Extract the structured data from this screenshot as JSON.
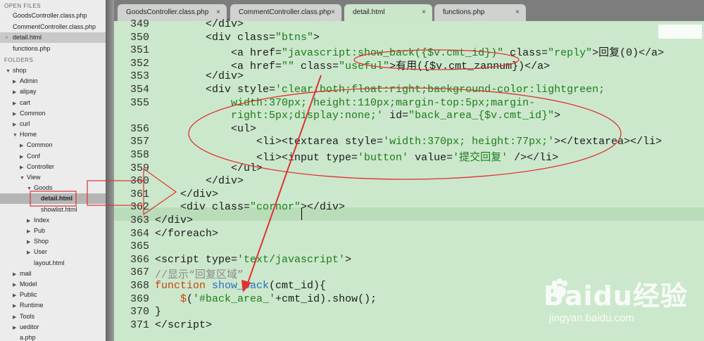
{
  "sidebar": {
    "open_files_header": "OPEN FILES",
    "folders_header": "FOLDERS",
    "open_files": [
      {
        "label": "GoodsController.class.php",
        "active": false
      },
      {
        "label": "CommentController.class.php",
        "active": false
      },
      {
        "label": "detail.html",
        "active": true
      },
      {
        "label": "functions.php",
        "active": false
      }
    ],
    "tree": [
      {
        "label": "shop",
        "depth": 0,
        "expanded": true
      },
      {
        "label": "Admin",
        "depth": 1,
        "expanded": false
      },
      {
        "label": "alipay",
        "depth": 1,
        "expanded": false
      },
      {
        "label": "cart",
        "depth": 1,
        "expanded": false
      },
      {
        "label": "Common",
        "depth": 1,
        "expanded": false
      },
      {
        "label": "curl",
        "depth": 1,
        "expanded": false
      },
      {
        "label": "Home",
        "depth": 1,
        "expanded": true
      },
      {
        "label": "Common",
        "depth": 2,
        "expanded": false
      },
      {
        "label": "Conf",
        "depth": 2,
        "expanded": false
      },
      {
        "label": "Controller",
        "depth": 2,
        "expanded": false
      },
      {
        "label": "View",
        "depth": 2,
        "expanded": true
      },
      {
        "label": "Goods",
        "depth": 3,
        "expanded": true
      },
      {
        "label": "detail.html",
        "depth": 4,
        "file": true,
        "selected": true
      },
      {
        "label": "showlist.html",
        "depth": 4,
        "file": true
      },
      {
        "label": "Index",
        "depth": 3,
        "expanded": false
      },
      {
        "label": "Pub",
        "depth": 3,
        "expanded": false
      },
      {
        "label": "Shop",
        "depth": 3,
        "expanded": false
      },
      {
        "label": "User",
        "depth": 3,
        "expanded": false
      },
      {
        "label": "layout.html",
        "depth": 3,
        "file": true
      },
      {
        "label": "mail",
        "depth": 1,
        "expanded": false
      },
      {
        "label": "Model",
        "depth": 1,
        "expanded": false
      },
      {
        "label": "Public",
        "depth": 1,
        "expanded": false
      },
      {
        "label": "Runtime",
        "depth": 1,
        "expanded": false
      },
      {
        "label": "Tools",
        "depth": 1,
        "expanded": false
      },
      {
        "label": "ueditor",
        "depth": 1,
        "expanded": false
      },
      {
        "label": "a.php",
        "depth": 1,
        "file": true
      }
    ]
  },
  "tabs": [
    {
      "label": "GoodsController.class.php",
      "active": false
    },
    {
      "label": "CommentController.class.php",
      "active": false
    },
    {
      "label": "detail.html",
      "active": true
    },
    {
      "label": "functions.php",
      "active": false
    }
  ],
  "editor": {
    "lines": [
      {
        "n": "349",
        "html": "        &lt;/div&gt;"
      },
      {
        "n": "350",
        "html": "        &lt;div class=<span class='kw'>\"btns\"</span>&gt;"
      },
      {
        "n": "351",
        "html": "            &lt;a href=<span class='kw'>\"javascript:show_back({$v.cmt_id})\"</span> class=<span class='kw'>\"reply\"</span>&gt;回复(0)&lt;/a&gt;"
      },
      {
        "n": "352",
        "html": "            &lt;a href=<span class='kw'>\"\"</span> class=<span class='kw'>\"useful\"</span>&gt;有用({$v.cmt_zannum})&lt;/a&gt;"
      },
      {
        "n": "353",
        "html": "        &lt;/div&gt;"
      },
      {
        "n": "354",
        "html": "        &lt;div style=<span class='kw'>'clear:both;float:right;background-color:lightgreen;</span>"
      },
      {
        "n": "355",
        "html": "<span class='kw'>            width:370px; height:110px;margin-top:5px;margin-</span>"
      },
      {
        "n": "",
        "html": "<span class='kw'>            right:5px;display:none;'</span> id=<span class='kw'>\"back_area_{$v.cmt_id}\"</span>&gt;"
      },
      {
        "n": "356",
        "html": "            &lt;ul&gt;"
      },
      {
        "n": "357",
        "html": "                &lt;li&gt;&lt;textarea style=<span class='kw'>'width:370px; height:77px;'</span>&gt;&lt;/textarea&gt;&lt;/li&gt;"
      },
      {
        "n": "358",
        "html": "                &lt;li&gt;&lt;input type=<span class='kw'>'button'</span> value=<span class='kw'>'提交回复'</span> /&gt;&lt;/li&gt;"
      },
      {
        "n": "359",
        "html": "            &lt;/ul&gt;"
      },
      {
        "n": "360",
        "html": "        &lt;/div&gt;"
      },
      {
        "n": "361",
        "html": "    &lt;/div&gt;"
      },
      {
        "n": "362",
        "html": "    &lt;div class=<span class='kw'>\"cornor\"</span>&gt;&lt;/div&gt;"
      },
      {
        "n": "363",
        "html": "&lt;/div&gt;"
      },
      {
        "n": "364",
        "html": "&lt;/foreach&gt;"
      },
      {
        "n": "365",
        "html": ""
      },
      {
        "n": "366",
        "html": "&lt;script type=<span class='kw'>'text/javascript'</span>&gt;"
      },
      {
        "n": "367",
        "html": "<span class='cmt'>//显示“回复区域”</span>"
      },
      {
        "n": "368",
        "html": "<span class='kwr'>function</span> <span class='fn'>show_back</span>(cmt_id){"
      },
      {
        "n": "369",
        "html": "    <span class='kwr'>$</span>(<span class='kw'>'#back_area_'</span>+cmt_id).show();"
      },
      {
        "n": "370",
        "html": "}"
      },
      {
        "n": "371",
        "html": "&lt;/script&gt;"
      }
    ]
  },
  "watermark": {
    "brand": "Baidu经验",
    "url": "jingyan.baidu.com"
  },
  "colors": {
    "editor_bg": "#cce8cc",
    "annotation_red": "#e03030",
    "string_green": "#1c7c1c"
  }
}
